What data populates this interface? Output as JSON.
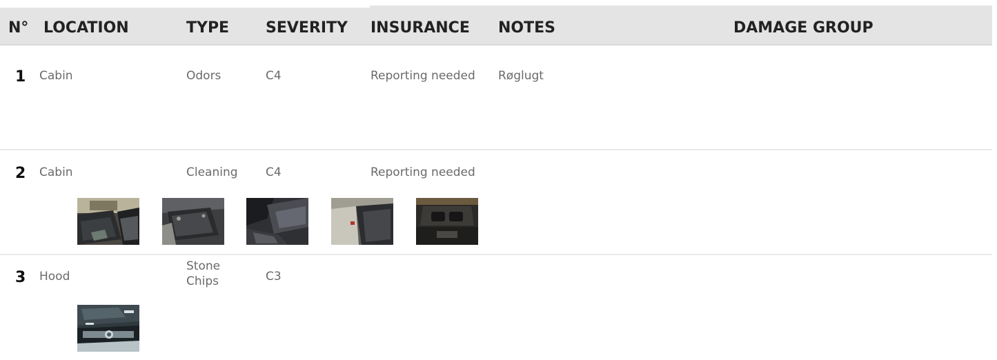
{
  "header": {
    "no": "N°",
    "location": "LOCATION",
    "type": "TYPE",
    "severity": "SEVERITY",
    "insurance": "INSURANCE",
    "notes": "NOTES",
    "damage_group": "DAMAGE GROUP"
  },
  "rows": [
    {
      "number": "1",
      "location": "Cabin",
      "type": "Odors",
      "severity": "C4",
      "insurance": "Reporting needed",
      "notes": "Røglugt",
      "photos": []
    },
    {
      "number": "2",
      "location": "Cabin",
      "type": "Cleaning",
      "severity": "C4",
      "insurance": "Reporting needed",
      "notes": "",
      "photos": [
        "seat-photo",
        "floor-mat-photo",
        "footwell-photo",
        "rear-floor-photo",
        "center-console-photo"
      ]
    },
    {
      "number": "3",
      "location": "Hood",
      "type_line1": "Stone",
      "type_line2": "Chips",
      "severity": "C3",
      "insurance": "",
      "notes": "",
      "photos": [
        "hood-photo"
      ]
    }
  ]
}
